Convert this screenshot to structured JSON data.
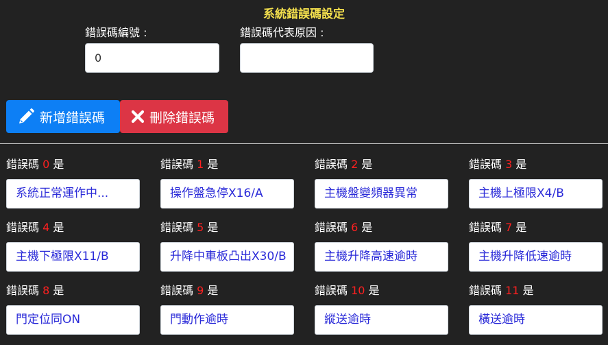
{
  "header": {
    "title": "系統錯誤碼設定"
  },
  "form": {
    "code_label": "錯誤碼編號 :",
    "code_value": "0",
    "reason_label": "錯誤碼代表原因 :",
    "reason_value": ""
  },
  "toolbar": {
    "add_label": "新增錯誤碼",
    "delete_label": "刪除錯誤碼"
  },
  "codes": {
    "prefix": "錯誤碼",
    "suffix": "是",
    "items": [
      {
        "code": "0",
        "desc": "系統正常運作中..."
      },
      {
        "code": "1",
        "desc": "操作盤急停X16/A"
      },
      {
        "code": "2",
        "desc": "主機盤變頻器異常"
      },
      {
        "code": "3",
        "desc": "主機上極限X4/B"
      },
      {
        "code": "4",
        "desc": "主機下極限X11/B"
      },
      {
        "code": "5",
        "desc": "升降中車板凸出X30/B"
      },
      {
        "code": "6",
        "desc": "主機升降高速逾時"
      },
      {
        "code": "7",
        "desc": "主機升降低速逾時"
      },
      {
        "code": "8",
        "desc": "門定位同ON"
      },
      {
        "code": "9",
        "desc": "門動作逾時"
      },
      {
        "code": "10",
        "desc": "縱送逾時"
      },
      {
        "code": "11",
        "desc": "橫送逾時"
      }
    ]
  },
  "colors": {
    "background": "#222222",
    "title": "#f4e04d",
    "add_button": "#0d7ff5",
    "delete_button": "#dc3545",
    "code_number": "#ff2020",
    "desc_text": "#2a2ad8"
  },
  "icons": {
    "add": "pencil-icon",
    "delete": "close-icon"
  }
}
